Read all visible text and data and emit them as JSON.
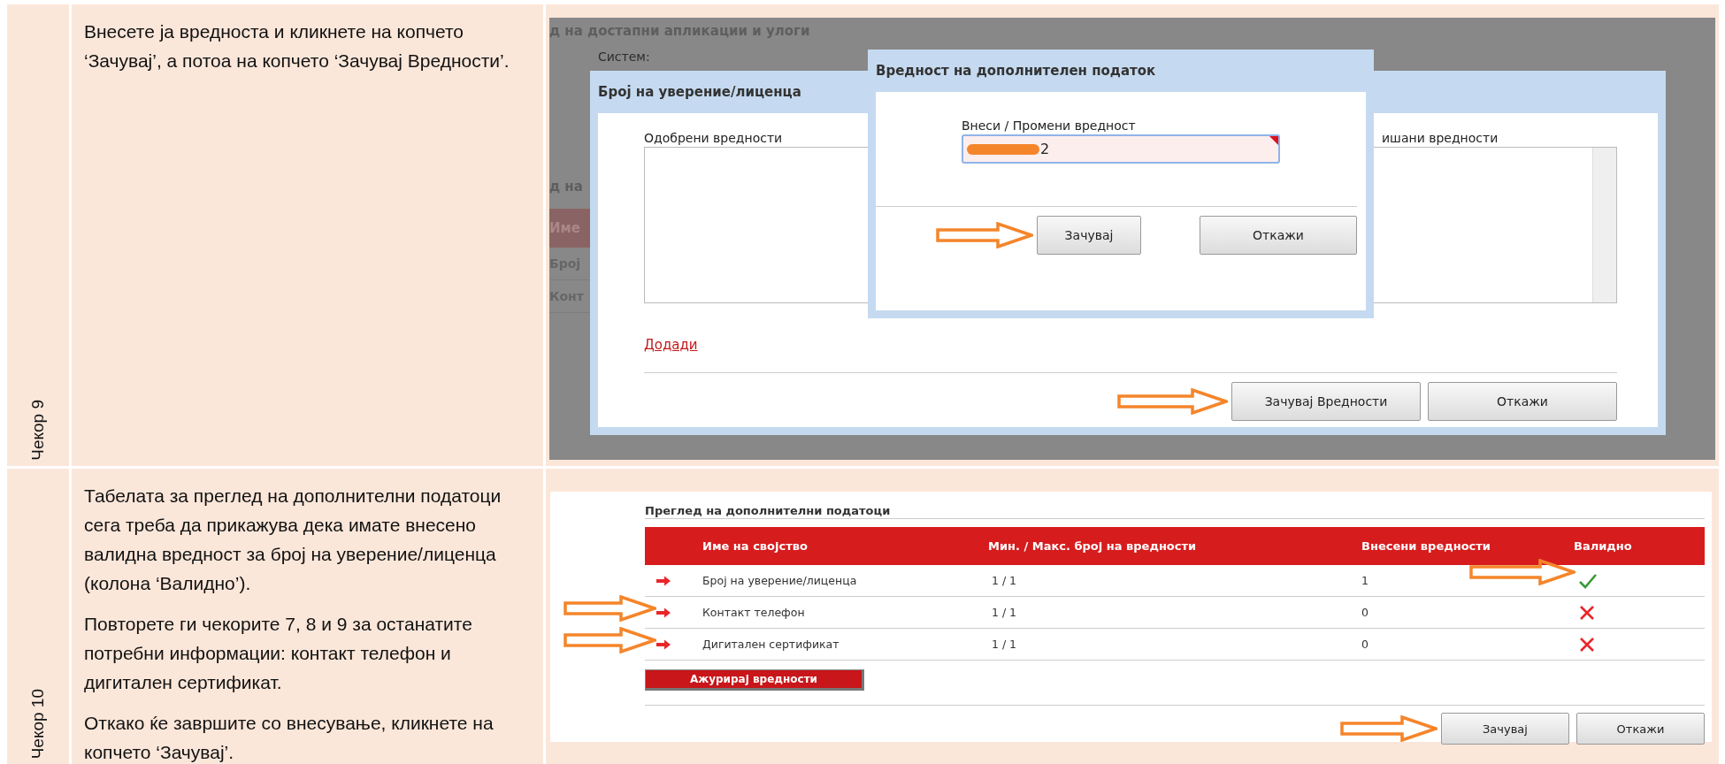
{
  "steps": [
    {
      "label": "Чекор 9",
      "paragraphs": [
        "Внесете ја вредноста и кликнете на копчето ‘Зачувај’, а потоа на копчето ‘Зачувај Вредности’."
      ],
      "screenshot": {
        "kind": "dialogs",
        "background_page": {
          "title": "д на достапни апликации и улоги",
          "label": "Систем:",
          "section": "д на",
          "header": "Име",
          "rows": [
            "Број",
            "Конт"
          ]
        },
        "license_dialog": {
          "title": "Број на уверение/лиценца",
          "approved_label": "Одобрени вредности",
          "assigned_label": "ишани вредности",
          "add_link": "Додади",
          "buttons": [
            {
              "label": "Зачувај Вредности",
              "callout": true
            },
            {
              "label": "Откажи",
              "callout": false
            }
          ]
        },
        "value_dialog": {
          "title": "Вредност на дополнителен податок",
          "field_label": "Внеси / Промени вредност",
          "value": "2",
          "redacted": true,
          "invalid": true,
          "buttons": [
            {
              "label": "Зачувај",
              "callout": true
            },
            {
              "label": "Откажи",
              "callout": false
            }
          ]
        }
      }
    },
    {
      "label": "Чекор 10",
      "paragraphs": [
        "Табелата за преглед на дополнителни податоци сега треба да прикажува дека имате внесено валидна вредност за број на уверение/лиценца (колона ‘Валидно’).",
        "Повторете ги чекорите 7, 8 и 9 за останатите потребни информации: контакт телефон и дигитален сертификат.",
        "Откако ќе завршите со внесување, кликнете на копчето ‘Зачувај’."
      ],
      "screenshot": {
        "kind": "overview",
        "title": "Преглед на дополнителни податоци",
        "columns": [
          "Име на својство",
          "Мин. / Макс. број на вредности",
          "Внесени вредности",
          "Валидно"
        ],
        "rows": [
          {
            "name": "Број на уверение/лиценца",
            "min_max": "1 / 1",
            "entered": "1",
            "valid": true,
            "name_callout": false,
            "valid_callout": true
          },
          {
            "name": "Контакт телефон",
            "min_max": "1 / 1",
            "entered": "0",
            "valid": false,
            "name_callout": true,
            "valid_callout": false
          },
          {
            "name": "Дигитален сертификат",
            "min_max": "1 / 1",
            "entered": "0",
            "valid": false,
            "name_callout": true,
            "valid_callout": false
          }
        ],
        "update_button": "Ажурирај вредности",
        "buttons": [
          {
            "label": "Зачувај",
            "callout": true
          },
          {
            "label": "Откажи",
            "callout": false
          }
        ]
      }
    }
  ]
}
